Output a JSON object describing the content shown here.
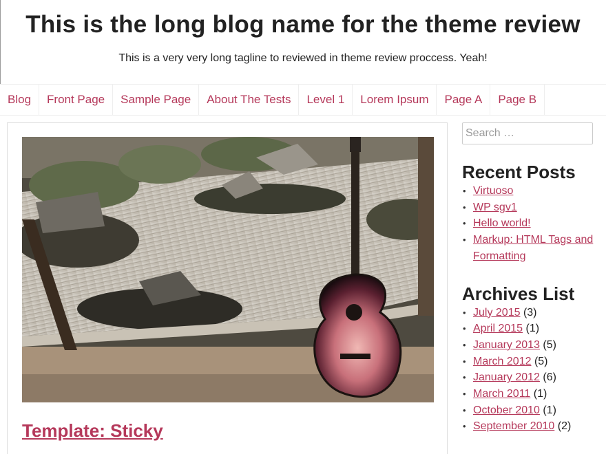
{
  "site": {
    "title": "This is the long blog name for the theme review",
    "tagline": "This is a very very long tagline to reviewed in theme review proccess. Yeah!"
  },
  "nav": {
    "items": [
      {
        "label": "Blog"
      },
      {
        "label": "Front Page"
      },
      {
        "label": "Sample Page"
      },
      {
        "label": "About The Tests"
      },
      {
        "label": "Level 1"
      },
      {
        "label": "Lorem Ipsum"
      },
      {
        "label": "Page A"
      },
      {
        "label": "Page B"
      }
    ]
  },
  "post": {
    "title": "Template: Sticky",
    "image_subject": "guitar-in-zen-garden-photo"
  },
  "sidebar": {
    "search": {
      "placeholder": "Search …"
    },
    "recent_posts": {
      "title": "Recent Posts",
      "items": [
        {
          "label": "Virtuoso"
        },
        {
          "label": "WP sgv1"
        },
        {
          "label": "Hello world!"
        },
        {
          "label": "Markup: HTML Tags and Formatting"
        }
      ]
    },
    "archives": {
      "title": "Archives List",
      "items": [
        {
          "label": "July 2015",
          "count": "(3)"
        },
        {
          "label": "April 2015",
          "count": "(1)"
        },
        {
          "label": "January 2013",
          "count": "(5)"
        },
        {
          "label": "March 2012",
          "count": "(5)"
        },
        {
          "label": "January 2012",
          "count": "(6)"
        },
        {
          "label": "March 2011",
          "count": "(1)"
        },
        {
          "label": "October 2010",
          "count": "(1)"
        },
        {
          "label": "September 2010",
          "count": "(2)"
        }
      ]
    }
  },
  "colors": {
    "link": "#b5385a",
    "text": "#222222",
    "border": "#eeeeee"
  }
}
